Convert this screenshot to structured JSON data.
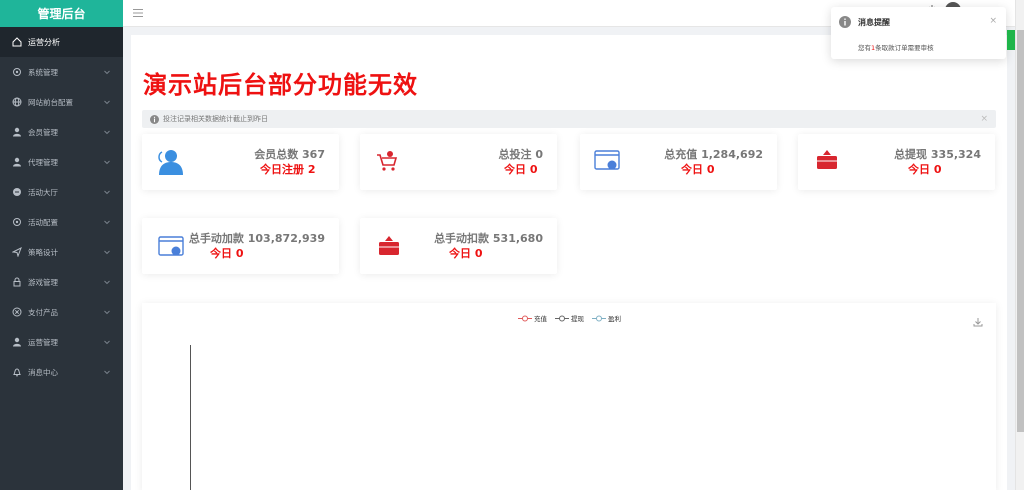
{
  "brand": "管理后台",
  "sidebar": {
    "items": [
      {
        "label": "运营分析",
        "icon": "home-icon",
        "active": true
      },
      {
        "label": "系统管理",
        "icon": "settings-icon"
      },
      {
        "label": "网站前台配置",
        "icon": "globe-icon"
      },
      {
        "label": "会员管理",
        "icon": "user-icon"
      },
      {
        "label": "代理管理",
        "icon": "user-icon"
      },
      {
        "label": "活动大厅",
        "icon": "chat-icon"
      },
      {
        "label": "活动配置",
        "icon": "settings-icon"
      },
      {
        "label": "策略设计",
        "icon": "send-icon"
      },
      {
        "label": "游戏管理",
        "icon": "lock-icon"
      },
      {
        "label": "支付产品",
        "icon": "close-circle-icon"
      },
      {
        "label": "运营管理",
        "icon": "user-icon"
      },
      {
        "label": "消息中心",
        "icon": "bell-icon"
      }
    ]
  },
  "main": {
    "title": "演示站后台部分功能无效",
    "notice": "投注记录相关数据统计截止到昨日",
    "cards": [
      {
        "main": "会员总数 367",
        "sub": "今日注册 2",
        "icon": "members-icon"
      },
      {
        "main": "总投注 0",
        "sub": "今日 0",
        "icon": "cart-icon"
      },
      {
        "main": "总充值 1,284,692",
        "sub": "今日 0",
        "icon": "recharge-icon"
      },
      {
        "main": "总提现 335,324",
        "sub": "今日 0",
        "icon": "withdraw-icon"
      },
      {
        "main": "总手动加款 103,872,939",
        "sub": "今日 0",
        "icon": "recharge-icon"
      },
      {
        "main": "总手动扣款 531,680",
        "sub": "今日 0",
        "icon": "withdraw-icon"
      }
    ]
  },
  "chart_data": {
    "type": "line",
    "series": [
      {
        "name": "充值",
        "color": "#e05a5a"
      },
      {
        "name": "提现",
        "color": "#666666"
      },
      {
        "name": "盈利",
        "color": "#7fb0c4"
      }
    ]
  },
  "notification": {
    "title": "消息提醒",
    "body_prefix": "您有",
    "count": "1",
    "body_suffix": "条取款订单需要审核"
  },
  "colors": {
    "accent": "#1fb59a",
    "alert": "#ee1111",
    "sidebar": "#2b333b"
  }
}
